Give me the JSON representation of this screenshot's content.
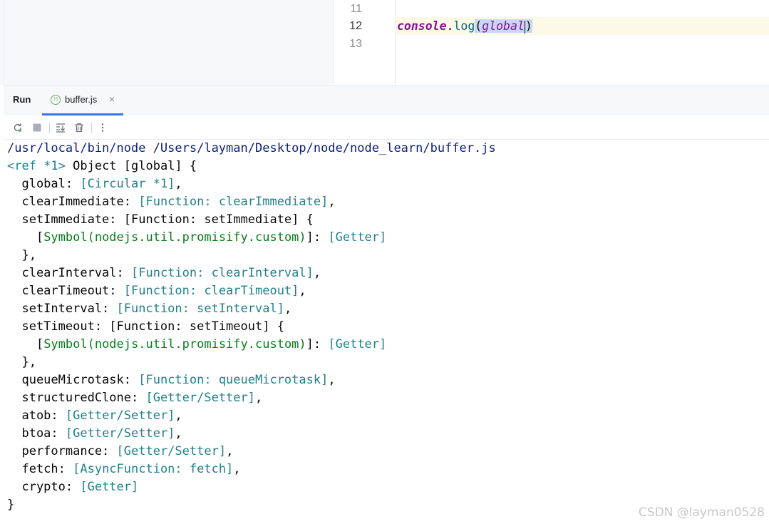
{
  "editor": {
    "line_numbers": [
      "11",
      "12",
      "13"
    ],
    "code": {
      "object": "console",
      "dot": ".",
      "method": "log",
      "open_paren": "(",
      "argument": "global",
      "close_paren": ")"
    }
  },
  "run_panel": {
    "title": "Run",
    "tab_label": "buffer.js",
    "tab_icon_text": "JS",
    "close_glyph": "×"
  },
  "toolbar": {
    "icons": [
      "rerun-icon",
      "stop-icon",
      "scroll-to-end-icon",
      "clear-all-icon",
      "more-options-icon"
    ]
  },
  "console": {
    "command_line": "/usr/local/bin/node /Users/layman/Desktop/node/node_learn/buffer.js",
    "lines": [
      {
        "plain": "",
        "teal": "<ref *1>",
        "rest": " Object [global] {"
      },
      {
        "plain": "  global: ",
        "teal": "[Circular *1]",
        "rest": ","
      },
      {
        "plain": "  clearImmediate: ",
        "teal": "[Function: clearImmediate]",
        "rest": ","
      },
      {
        "plain": "  setImmediate: [Function: setImmediate] {",
        "teal": "",
        "rest": ""
      },
      {
        "symbol": true,
        "plain": "    [",
        "green": "Symbol(nodejs.util.promisify.custom)",
        "mid": "]: ",
        "teal": "[Getter]"
      },
      {
        "plain": "  },",
        "teal": "",
        "rest": ""
      },
      {
        "plain": "  clearInterval: ",
        "teal": "[Function: clearInterval]",
        "rest": ","
      },
      {
        "plain": "  clearTimeout: ",
        "teal": "[Function: clearTimeout]",
        "rest": ","
      },
      {
        "plain": "  setInterval: ",
        "teal": "[Function: setInterval]",
        "rest": ","
      },
      {
        "plain": "  setTimeout: [Function: setTimeout] {",
        "teal": "",
        "rest": ""
      },
      {
        "symbol": true,
        "plain": "    [",
        "green": "Symbol(nodejs.util.promisify.custom)",
        "mid": "]: ",
        "teal": "[Getter]"
      },
      {
        "plain": "  },",
        "teal": "",
        "rest": ""
      },
      {
        "plain": "  queueMicrotask: ",
        "teal": "[Function: queueMicrotask]",
        "rest": ","
      },
      {
        "plain": "  structuredClone: ",
        "teal": "[Getter/Setter]",
        "rest": ","
      },
      {
        "plain": "  atob: ",
        "teal": "[Getter/Setter]",
        "rest": ","
      },
      {
        "plain": "  btoa: ",
        "teal": "[Getter/Setter]",
        "rest": ","
      },
      {
        "plain": "  performance: ",
        "teal": "[Getter/Setter]",
        "rest": ","
      },
      {
        "plain": "  fetch: ",
        "teal": "[AsyncFunction: fetch]",
        "rest": ","
      },
      {
        "plain": "  crypto: ",
        "teal": "[Getter]",
        "rest": ""
      },
      {
        "plain": "}",
        "teal": "",
        "rest": ""
      }
    ]
  },
  "watermark": "CSDN @layman0528",
  "colors": {
    "accent": "#3574f0",
    "teal_output": "#20808d",
    "green_symbol": "#067d17",
    "keyword_purple": "#871094",
    "current_line": "#fdf9e7"
  }
}
